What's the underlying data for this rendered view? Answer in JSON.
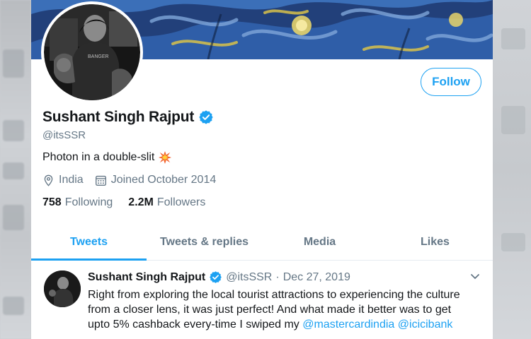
{
  "profile": {
    "display_name": "Sushant Singh Rajput",
    "handle": "@itsSSR",
    "bio": "Photon in a double-slit",
    "location": "India",
    "joined": "Joined October 2014",
    "following_count": "758",
    "following_label": "Following",
    "followers_count": "2.2M",
    "followers_label": "Followers",
    "follow_button": "Follow",
    "avatar_shirt_text": "BANGER"
  },
  "tabs": [
    {
      "label": "Tweets",
      "active": true
    },
    {
      "label": "Tweets & replies",
      "active": false
    },
    {
      "label": "Media",
      "active": false
    },
    {
      "label": "Likes",
      "active": false
    }
  ],
  "tweet": {
    "author": "Sushant Singh Rajput",
    "handle": "@itsSSR",
    "separator": "·",
    "date": "Dec 27, 2019",
    "text_before_mention": "Right from exploring the local tourist attractions to experiencing the culture from a closer lens, it was just perfect! And what made it better was to get upto 5% cashback every-time I swiped my ",
    "mention_1": "@mastercardindia",
    "mention_2": "@icicibank"
  },
  "icons": {
    "verified": "verified-badge-icon",
    "location": "location-pin-icon",
    "calendar": "calendar-icon",
    "burst": "collision-emoji-icon",
    "caret": "chevron-down-icon"
  },
  "colors": {
    "accent": "#1da1f2",
    "secondary_text": "#657786",
    "primary_text": "#14171a"
  }
}
